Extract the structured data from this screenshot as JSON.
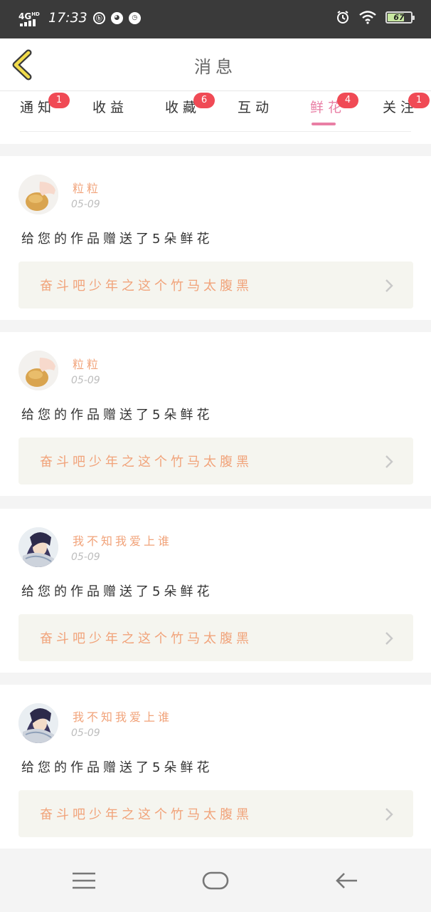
{
  "status_bar": {
    "network": "4G",
    "network_sup": "HD",
    "time": "17:33",
    "battery": "67",
    "battery_level": 0.67,
    "left_icons": [
      "hd-call-icon",
      "app-notification-icon",
      "alarm-icon"
    ],
    "right_icons": [
      "alarm-icon",
      "wifi-icon",
      "battery-icon"
    ]
  },
  "header": {
    "title": "消息",
    "back_icon": "chevron-left-icon"
  },
  "tabs": [
    {
      "label": "通知",
      "badge": "1",
      "active": false
    },
    {
      "label": "收益",
      "badge": "",
      "active": false
    },
    {
      "label": "收藏",
      "badge": "6",
      "active": false
    },
    {
      "label": "互动",
      "badge": "",
      "active": false
    },
    {
      "label": "鲜花",
      "badge": "4",
      "active": true
    },
    {
      "label": "关注",
      "badge": "1",
      "active": false
    }
  ],
  "messages": [
    {
      "user": "粒粒",
      "avatar": "bread-hand-avatar",
      "date": "05-09",
      "text": "给您的作品赠送了5朵鲜花",
      "work_title": "奋斗吧少年之这个竹马太腹黑"
    },
    {
      "user": "粒粒",
      "avatar": "bread-hand-avatar",
      "date": "05-09",
      "text": "给您的作品赠送了5朵鲜花",
      "work_title": "奋斗吧少年之这个竹马太腹黑"
    },
    {
      "user": "我不知我爱上谁",
      "avatar": "anime-character-avatar",
      "date": "05-09",
      "text": "给您的作品赠送了5朵鲜花",
      "work_title": "奋斗吧少年之这个竹马太腹黑"
    },
    {
      "user": "我不知我爱上谁",
      "avatar": "anime-character-avatar",
      "date": "05-09",
      "text": "给您的作品赠送了5朵鲜花",
      "work_title": "奋斗吧少年之这个竹马太腹黑"
    }
  ],
  "nav_bar": {
    "icons": [
      "menu-icon",
      "home-icon",
      "back-arrow-icon"
    ]
  },
  "colors": {
    "accent_pink": "#e97fa5",
    "badge_red": "#f04a55",
    "username_orange": "#f1a37a",
    "back_icon_yellow": "#f2dc4c"
  }
}
